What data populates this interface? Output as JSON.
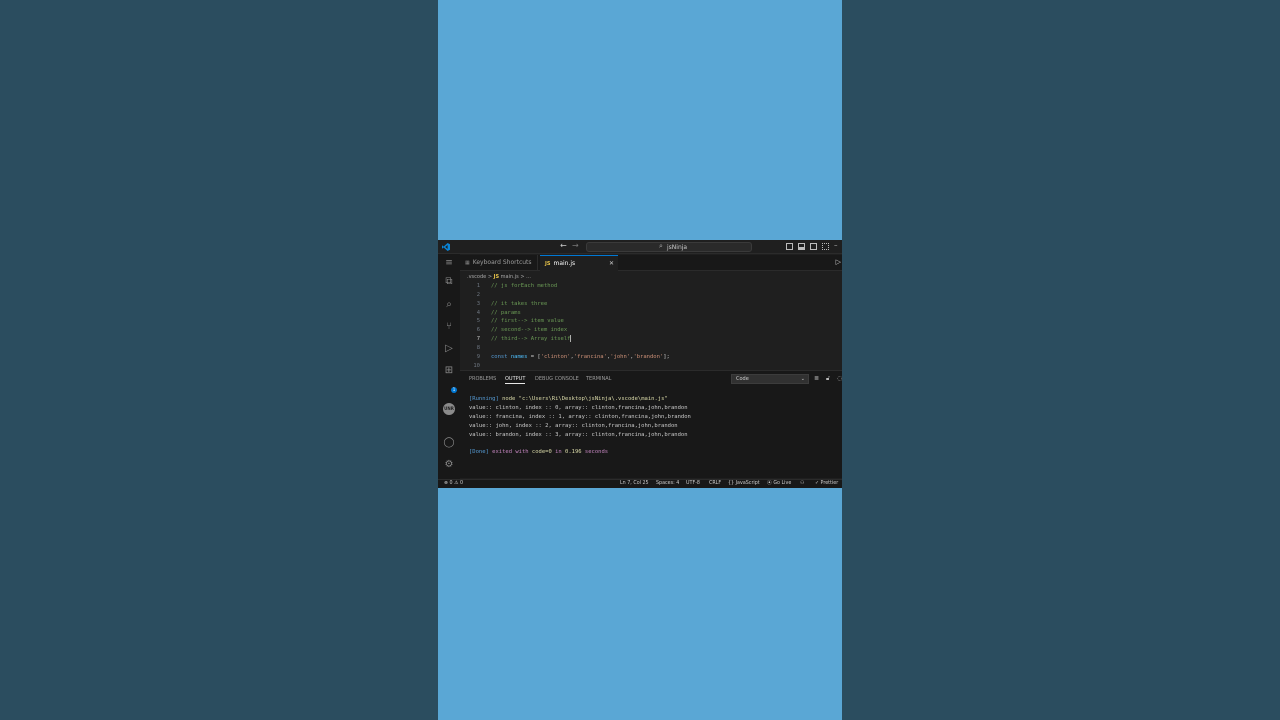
{
  "window": {
    "title": "jsNinja",
    "search_icon": "search-icon",
    "back_icon": "arrow-left-icon",
    "forward_icon": "arrow-right-icon"
  },
  "activity_bar": {
    "items": [
      "explorer-icon",
      "search-icon",
      "source-control-icon",
      "run-debug-icon",
      "extensions-icon",
      "remote-icon",
      "account-icon",
      "settings-gear-icon"
    ],
    "extensions_badge": "1",
    "remote_label": "UNR"
  },
  "tabs": [
    {
      "label": "Keyboard Shortcuts",
      "active": false
    },
    {
      "label": "main.js",
      "active": true,
      "close": "✕"
    }
  ],
  "breadcrumb": {
    "folder": ".vscode",
    "sep1": ">",
    "file_icon": "JS",
    "file": "main.js",
    "sep2": ">",
    "symbol": "..."
  },
  "editor": {
    "active_line": 7,
    "lines": [
      {
        "n": "1",
        "text": "// js forEach method"
      },
      {
        "n": "2",
        "text": ""
      },
      {
        "n": "3",
        "text": "// it takes three"
      },
      {
        "n": "4",
        "text": "// params"
      },
      {
        "n": "5",
        "text": "// first--> item value"
      },
      {
        "n": "6",
        "text": "// second--> item index"
      },
      {
        "n": "7",
        "text": "// third--> Array itself"
      },
      {
        "n": "8",
        "text": ""
      },
      {
        "n": "9",
        "keyword": "const",
        "name": "names",
        "rest": " = [",
        "s1": "'clinton'",
        "s2": "'francina'",
        "s3": "'john'",
        "s4": "'brandon'",
        "end": "];"
      },
      {
        "n": "10",
        "text": ""
      }
    ]
  },
  "panel": {
    "tabs": [
      "PROBLEMS",
      "OUTPUT",
      "DEBUG CONSOLE",
      "TERMINAL"
    ],
    "active_tab": "OUTPUT",
    "channel": "Code",
    "running_tag": "[Running]",
    "running_cmd": " node \"c:\\Users\\Ri\\Desktop\\jsNinja\\.vscode\\main.js\"",
    "output_lines": [
      "value:: clinton, index :: 0, array:: clinton,francina,john,brandon",
      "value:: francina, index :: 1, array:: clinton,francina,john,brandon",
      "value:: john, index :: 2, array:: clinton,francina,john,brandon",
      "value:: brandon, index :: 3, array:: clinton,francina,john,brandon"
    ],
    "done_tag": "[Done]",
    "done_text1": " exited with ",
    "done_code": "code=0",
    "done_text2": " in ",
    "done_time": "0.196",
    "done_text3": " seconds"
  },
  "statusbar": {
    "problems": "⊗ 0 ⚠ 0",
    "position": "Ln 7, Col 25",
    "spaces": "Spaces: 4",
    "encoding": "UTF-8",
    "eol": "CRLF",
    "language": "{} JavaScript",
    "golive": "⦿ Go Live",
    "prettier": "✓ Prettier"
  },
  "colors": {
    "accent": "#0078d4",
    "background_left_right": "#2b4d5f",
    "background_center": "#5aa7d5"
  }
}
